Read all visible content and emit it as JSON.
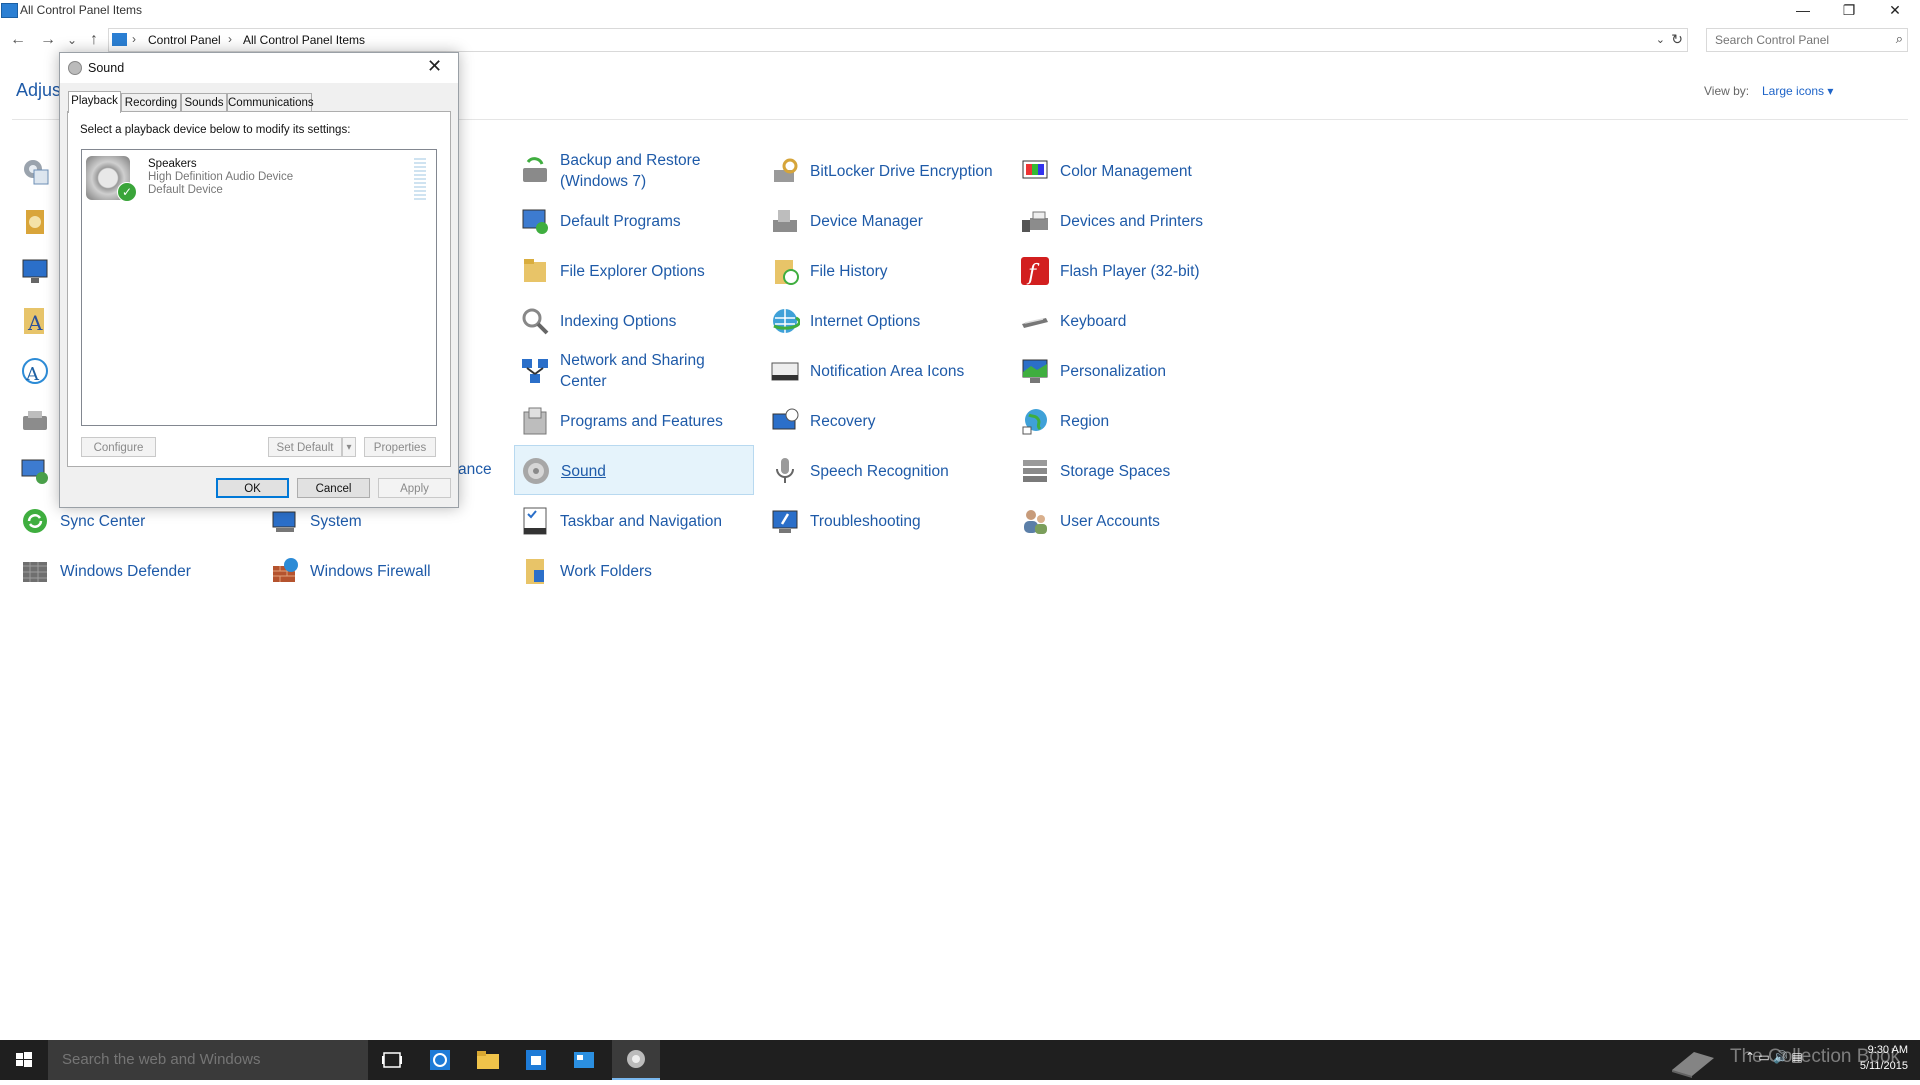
{
  "window": {
    "title": "All Control Panel Items",
    "minimize": "—",
    "restore": "❐",
    "close": "✕"
  },
  "nav": {
    "back": "←",
    "forward": "→",
    "recent": "⌄",
    "up": "↑"
  },
  "address": {
    "crumbs": [
      "Control Panel",
      "All Control Panel Items"
    ],
    "separator": "›",
    "dropdown": "⌄",
    "refresh": "↻"
  },
  "search": {
    "placeholder": "Search Control Panel",
    "icon": "⌕"
  },
  "header": {
    "title_visible": "Adjust",
    "view_by_label": "View by:",
    "view_by_value": "Large icons ▾"
  },
  "items": {
    "backup_restore": "Backup and Restore (Windows 7)",
    "bitlocker": "BitLocker Drive Encryption",
    "color_management": "Color Management",
    "default_programs": "Default Programs",
    "device_manager": "Device Manager",
    "devices_printers": "Devices and Printers",
    "file_explorer_options": "File Explorer Options",
    "file_history": "File History",
    "flash_player": "Flash Player (32-bit)",
    "indexing_options": "Indexing Options",
    "internet_options": "Internet Options",
    "keyboard": "Keyboard",
    "network_sharing": "Network and Sharing Center",
    "notification_area": "Notification Area Icons",
    "personalization": "Personalization",
    "programs_features": "Programs and Features",
    "recovery": "Recovery",
    "region": "Region",
    "partial_ance": "ance",
    "sound": "Sound",
    "speech_recognition": "Speech Recognition",
    "storage_spaces": "Storage Spaces",
    "sync_center": "Sync Center",
    "system": "System",
    "taskbar_navigation": "Taskbar and Navigation",
    "troubleshooting": "Troubleshooting",
    "user_accounts": "User Accounts",
    "windows_defender": "Windows Defender",
    "windows_firewall": "Windows Firewall",
    "work_folders": "Work Folders"
  },
  "dialog": {
    "title": "Sound",
    "close": "✕",
    "tabs": [
      "Playback",
      "Recording",
      "Sounds",
      "Communications"
    ],
    "instruction": "Select a playback device below to modify its settings:",
    "device": {
      "name": "Speakers",
      "description": "High Definition Audio Device",
      "status": "Default Device"
    },
    "buttons": {
      "configure": "Configure",
      "set_default": "Set Default",
      "set_default_arrow": "▾",
      "properties": "Properties",
      "ok": "OK",
      "cancel": "Cancel",
      "apply": "Apply"
    }
  },
  "taskbar": {
    "search_placeholder": "Search the web and Windows",
    "watermark": "The Collection Book",
    "time": "9:30 AM",
    "date": "5/11/2015",
    "tray": "⌃  ▭  🔊  ▤"
  },
  "colors": {
    "link": "#1e5aa8",
    "selection_bg": "#e5f3fb",
    "taskbar": "#1f1f1f",
    "accent": "#0078d7"
  }
}
